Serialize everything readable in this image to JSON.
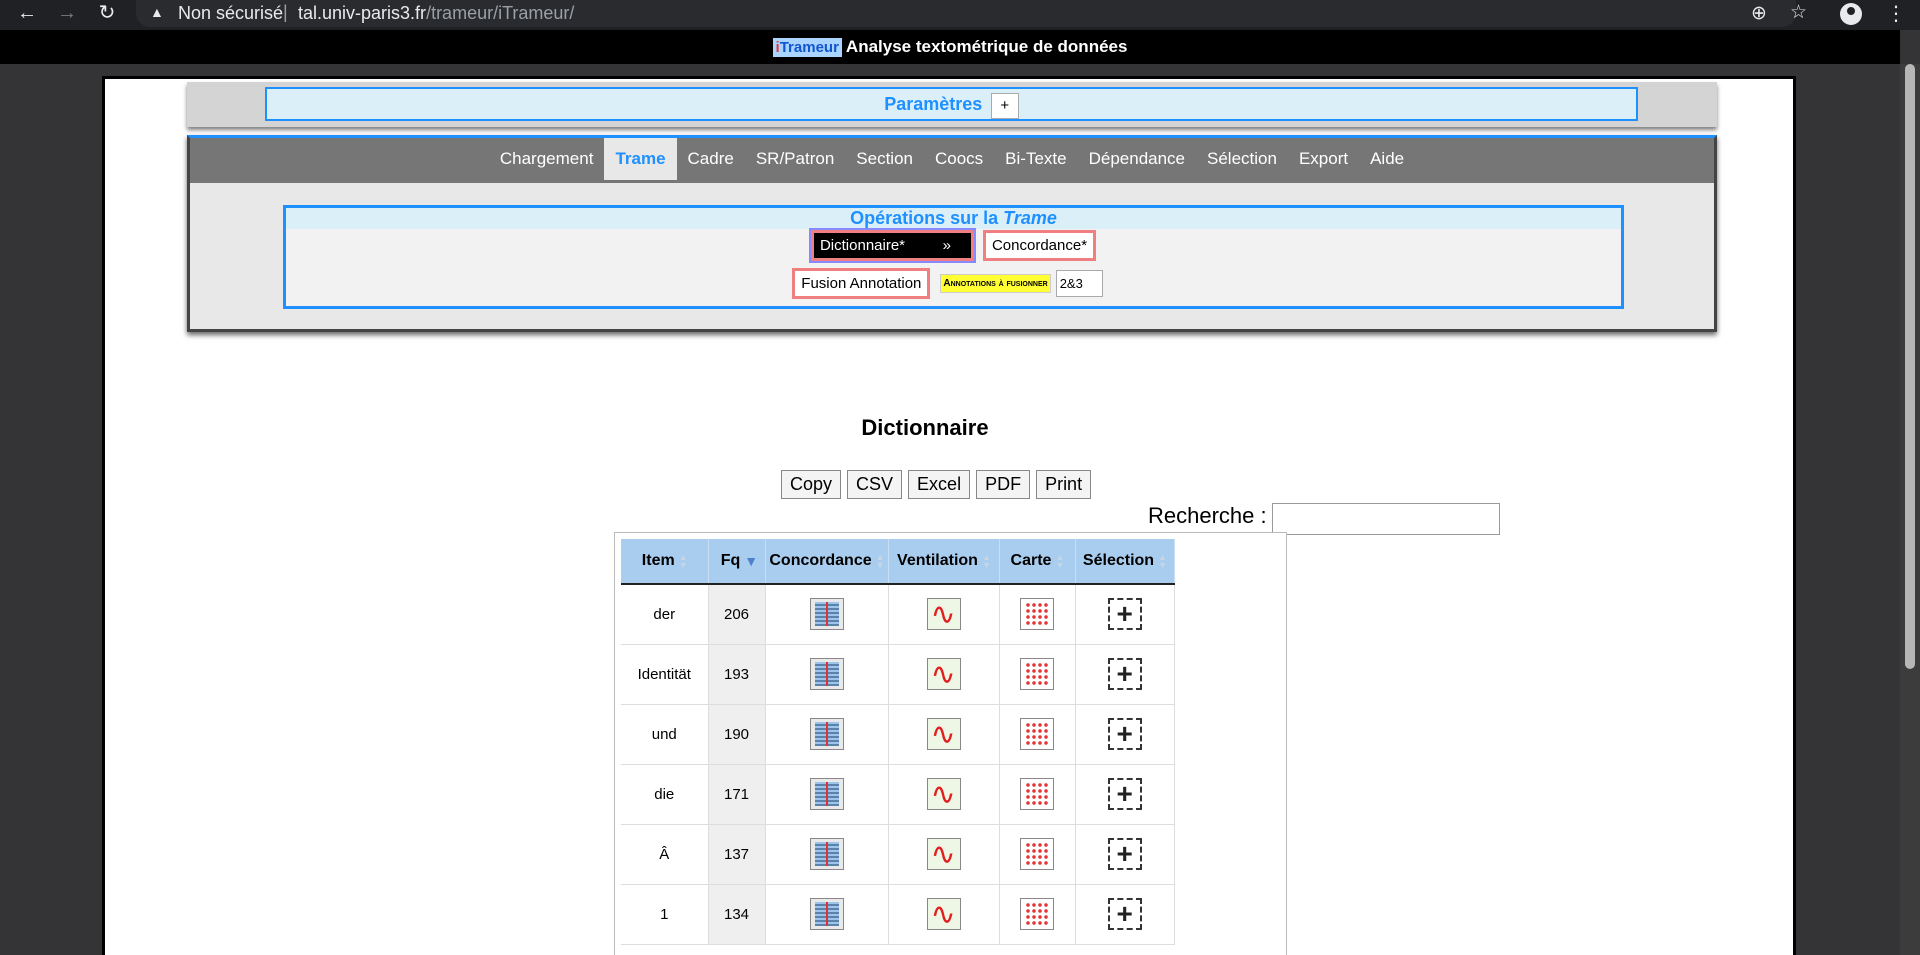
{
  "browser": {
    "security_state": "Non sécurisé",
    "url_host": "tal.univ-paris3.fr",
    "url_path": "/trameur/iTrameur/"
  },
  "app": {
    "logo_i": "i",
    "logo_rest": "Trameur",
    "title": "Analyse textométrique de données"
  },
  "params": {
    "title": "Paramètres",
    "toggle_label": "+"
  },
  "tabs": [
    {
      "label": "Chargement"
    },
    {
      "label": "Trame",
      "active": true
    },
    {
      "label": "Cadre"
    },
    {
      "label": "SR/Patron"
    },
    {
      "label": "Section"
    },
    {
      "label": "Coocs"
    },
    {
      "label": "Bi-Texte"
    },
    {
      "label": "Dépendance"
    },
    {
      "label": "Sélection"
    },
    {
      "label": "Export"
    },
    {
      "label": "Aide"
    }
  ],
  "operations": {
    "title_prefix": "Opérations sur la ",
    "title_em": "Trame",
    "dictionnaire_label": "Dictionnaire*",
    "dictionnaire_arrow": "»",
    "concordance_label": "Concordance*",
    "fusion_label": "Fusion Annotation",
    "annotations_label": "Annotations à fusionner",
    "annotations_value": "2&3"
  },
  "dictionary": {
    "heading": "Dictionnaire",
    "export_buttons": [
      "Copy",
      "CSV",
      "Excel",
      "PDF",
      "Print"
    ],
    "search_label": "Recherche :",
    "search_value": "",
    "columns": [
      "Item",
      "Fq",
      "Concordance",
      "Ventilation",
      "Carte",
      "Sélection"
    ],
    "sorted_column": "Fq",
    "rows": [
      {
        "item": "der",
        "fq": "206"
      },
      {
        "item": "Identität",
        "fq": "193"
      },
      {
        "item": "und",
        "fq": "190"
      },
      {
        "item": "die",
        "fq": "171"
      },
      {
        "item": "Â",
        "fq": "137"
      },
      {
        "item": "1",
        "fq": "134"
      }
    ]
  },
  "icons": {
    "concordance": "concordance-icon",
    "ventilation": "ventilation-chart-icon",
    "carte": "map-grid-icon",
    "selection": "add-selection-icon"
  }
}
